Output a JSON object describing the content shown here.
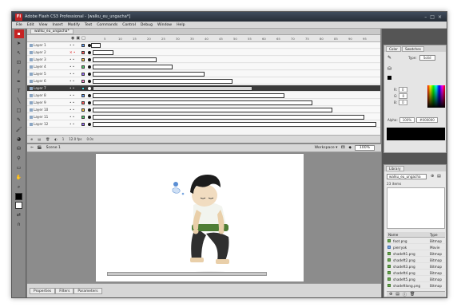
{
  "app": {
    "logo": "Fl",
    "title": "Adobe Flash CS3 Professional - [walku_eu_ungacha*]",
    "window_controls": [
      "–",
      "□",
      "×"
    ]
  },
  "menu": [
    "File",
    "Edit",
    "View",
    "Insert",
    "Modify",
    "Text",
    "Commands",
    "Control",
    "Debug",
    "Window",
    "Help"
  ],
  "timeline": {
    "doc_tab": "walku_eu_ungacha*",
    "ruler_ticks": [
      "5",
      "10",
      "15",
      "20",
      "25",
      "30",
      "35",
      "40",
      "45",
      "50",
      "55",
      "60",
      "65",
      "70",
      "75",
      "80",
      "85",
      "90",
      "95"
    ],
    "layers": [
      {
        "name": "Layer 1"
      },
      {
        "name": "Layer 2"
      },
      {
        "name": "Layer 3"
      },
      {
        "name": "Layer 4"
      },
      {
        "name": "Layer 5"
      },
      {
        "name": "Layer 6"
      },
      {
        "name": "Layer 7"
      },
      {
        "name": "Layer 8"
      },
      {
        "name": "Layer 9"
      },
      {
        "name": "Layer 10"
      },
      {
        "name": "Layer 11"
      },
      {
        "name": "Layer 12"
      }
    ],
    "status": [
      "1",
      "12.0 fps",
      "0.0s"
    ]
  },
  "stage": {
    "scene": "Scene 1",
    "workspace": "Workspace ▾",
    "zoom": "100%"
  },
  "properties": {
    "tabs": [
      "Properties",
      "Filters",
      "Parameters"
    ]
  },
  "color_panel": {
    "tabs": [
      "Color",
      "Swatches"
    ],
    "type_label": "Type:",
    "type_value": "Solid",
    "r": "0",
    "g": "0",
    "b": "0",
    "alpha_label": "Alpha:",
    "alpha_value": "100%",
    "hex": "#000000",
    "fill_color": "#000000"
  },
  "library": {
    "tab": "Library",
    "document": "walku_eu_ungacha",
    "count": "23 items",
    "col_name": "Name",
    "col_type": "Type",
    "items": [
      {
        "name": "foot.png",
        "type": "Bitmap"
      },
      {
        "name": "pierryok",
        "type": "Movie"
      },
      {
        "name": "shadeft1.png",
        "type": "Bitmap"
      },
      {
        "name": "shadeft2.png",
        "type": "Bitmap"
      },
      {
        "name": "shadeft3.png",
        "type": "Bitmap"
      },
      {
        "name": "shadeft4.png",
        "type": "Bitmap"
      },
      {
        "name": "shadeft5.png",
        "type": "Bitmap"
      },
      {
        "name": "shadeftlong.png",
        "type": "Bitmap"
      }
    ]
  }
}
